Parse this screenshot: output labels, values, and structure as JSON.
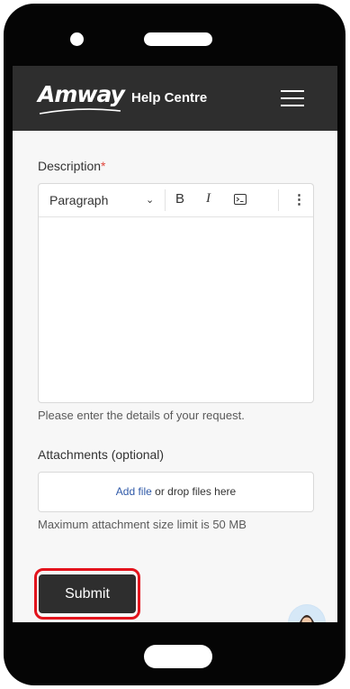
{
  "header": {
    "brand": "Amway",
    "title": "Help Centre",
    "menu_icon": "hamburger-menu-icon"
  },
  "form": {
    "description": {
      "label": "Description",
      "required_marker": "*",
      "toolbar": {
        "format_select": "Paragraph",
        "bold": "B",
        "italic": "I",
        "more": "⋮"
      },
      "value": "",
      "hint": "Please enter the details of your request."
    },
    "attachments": {
      "label": "Attachments (optional)",
      "add_file": "Add file",
      "drop_text": " or drop files here",
      "hint": "Maximum attachment size limit is 50 MB"
    },
    "submit_label": "Submit"
  },
  "colors": {
    "header_bg": "#2e2e2e",
    "required": "#e0463c",
    "link": "#2f59a8",
    "highlight": "#e3141d"
  }
}
